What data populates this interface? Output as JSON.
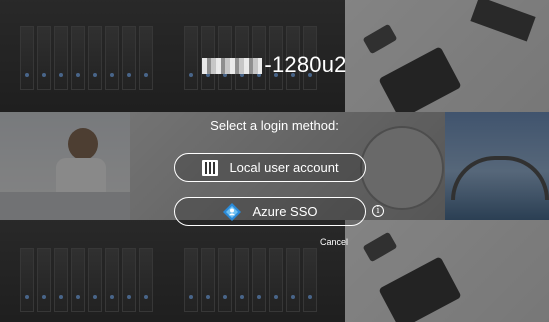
{
  "header": {
    "device_name": "-1280u2"
  },
  "login": {
    "prompt": "Select a login method:",
    "local_button": {
      "label": "Local user account",
      "icon": "local-account-icon"
    },
    "azure_button": {
      "label": "Azure SSO",
      "icon": "azure-icon"
    },
    "info_icon": "info-icon",
    "cancel_label": "Cancel"
  }
}
